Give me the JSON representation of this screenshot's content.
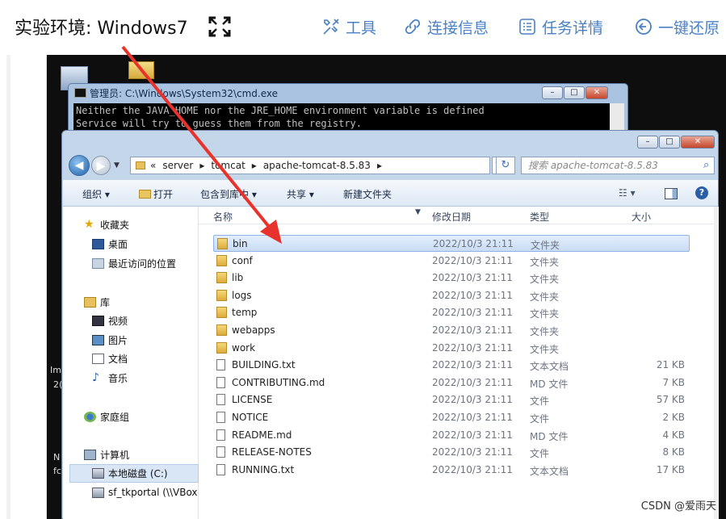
{
  "header": {
    "title": "实验环境: Windows7",
    "tools": "工具",
    "connection": "连接信息",
    "task": "任务详情",
    "restore": "一键还原"
  },
  "desktop": {
    "labels": [
      "Im",
      "2(",
      "N",
      "fc"
    ]
  },
  "cmd": {
    "title": "管理员: C:\\Windows\\System32\\cmd.exe",
    "lines": [
      "Neither the JAVA_HOME nor the JRE_HOME environment variable is defined",
      "Service will try to guess them from the registry."
    ]
  },
  "explorer": {
    "breadcrumb": [
      "«",
      "server",
      "tomcat",
      "apache-tomcat-8.5.83"
    ],
    "search_placeholder": "搜索 apache-tomcat-8.5.83",
    "toolbar": {
      "organize": "组织",
      "open": "打开",
      "include": "包含到库中",
      "share": "共享",
      "newfolder": "新建文件夹"
    },
    "nav": {
      "favorites": "收藏夹",
      "desktop": "桌面",
      "recent": "最近访问的位置",
      "libraries": "库",
      "videos": "视频",
      "pictures": "图片",
      "documents": "文档",
      "music": "音乐",
      "homegroup": "家庭组",
      "computer": "计算机",
      "cdrive": "本地磁盘 (C:)",
      "share": "sf_tkportal (\\\\VBox"
    },
    "columns": {
      "name": "名称",
      "date": "修改日期",
      "type": "类型",
      "size": "大小"
    },
    "files": [
      {
        "name": "bin",
        "date": "2022/10/3 21:11",
        "type": "文件夹",
        "size": "",
        "folder": true
      },
      {
        "name": "conf",
        "date": "2022/10/3 21:11",
        "type": "文件夹",
        "size": "",
        "folder": true
      },
      {
        "name": "lib",
        "date": "2022/10/3 21:11",
        "type": "文件夹",
        "size": "",
        "folder": true
      },
      {
        "name": "logs",
        "date": "2022/10/3 21:11",
        "type": "文件夹",
        "size": "",
        "folder": true
      },
      {
        "name": "temp",
        "date": "2022/10/3 21:11",
        "type": "文件夹",
        "size": "",
        "folder": true
      },
      {
        "name": "webapps",
        "date": "2022/10/3 21:11",
        "type": "文件夹",
        "size": "",
        "folder": true
      },
      {
        "name": "work",
        "date": "2022/10/3 21:11",
        "type": "文件夹",
        "size": "",
        "folder": true
      },
      {
        "name": "BUILDING.txt",
        "date": "2022/10/3 21:11",
        "type": "文本文档",
        "size": "21 KB",
        "folder": false
      },
      {
        "name": "CONTRIBUTING.md",
        "date": "2022/10/3 21:11",
        "type": "MD 文件",
        "size": "7 KB",
        "folder": false
      },
      {
        "name": "LICENSE",
        "date": "2022/10/3 21:11",
        "type": "文件",
        "size": "57 KB",
        "folder": false
      },
      {
        "name": "NOTICE",
        "date": "2022/10/3 21:11",
        "type": "文件",
        "size": "2 KB",
        "folder": false
      },
      {
        "name": "README.md",
        "date": "2022/10/3 21:11",
        "type": "MD 文件",
        "size": "4 KB",
        "folder": false
      },
      {
        "name": "RELEASE-NOTES",
        "date": "2022/10/3 21:11",
        "type": "文件",
        "size": "8 KB",
        "folder": false
      },
      {
        "name": "RUNNING.txt",
        "date": "2022/10/3 21:11",
        "type": "文本文档",
        "size": "17 KB",
        "folder": false
      }
    ]
  },
  "watermark": "CSDN @爱雨天"
}
